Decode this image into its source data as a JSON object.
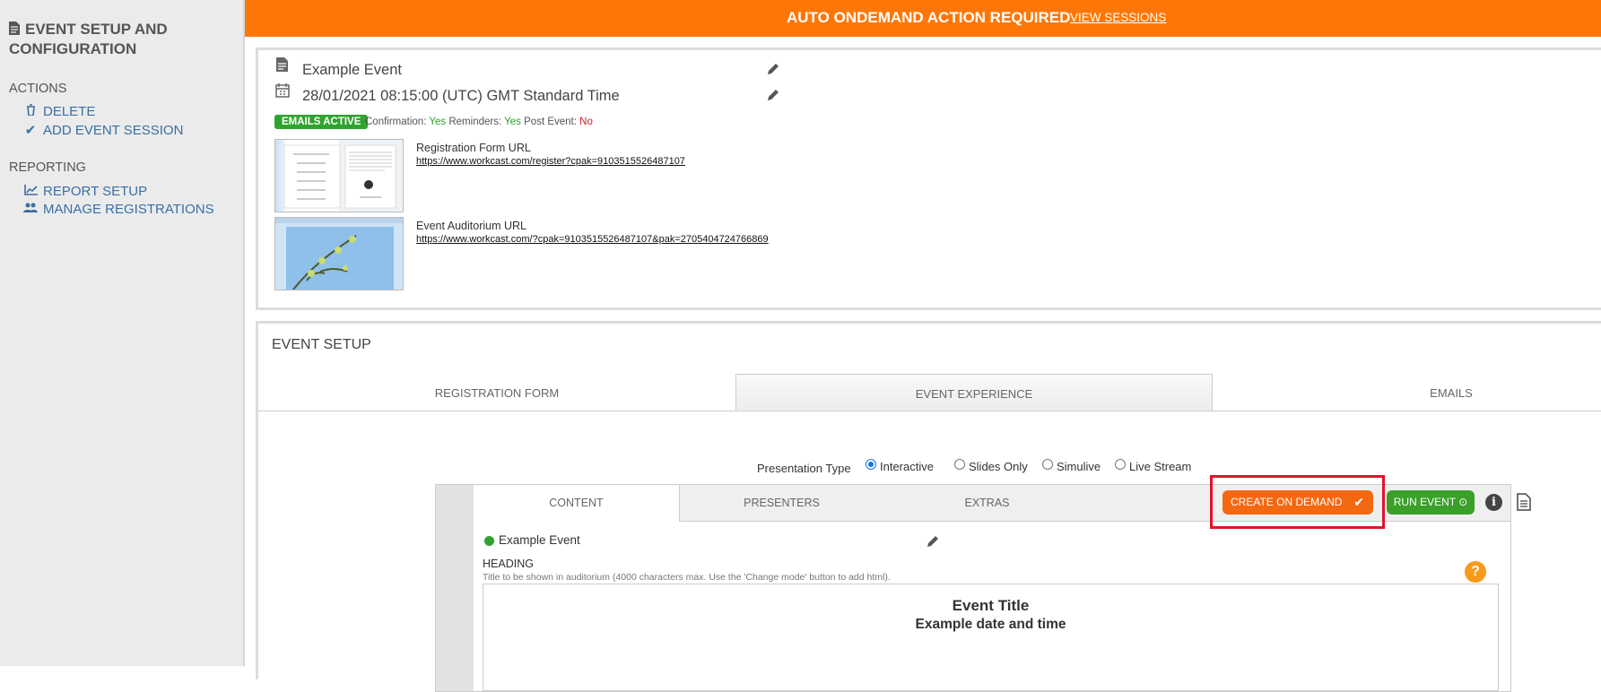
{
  "sidebar": {
    "title": "EVENT SETUP AND CONFIGURATION",
    "actions_heading": "ACTIONS",
    "actions": [
      {
        "label": "DELETE",
        "icon": "trash-icon"
      },
      {
        "label": "ADD EVENT SESSION",
        "icon": "check-icon"
      }
    ],
    "reporting_heading": "REPORTING",
    "reporting": [
      {
        "label": "REPORT SETUP",
        "icon": "line-chart-icon"
      },
      {
        "label": "MANAGE REGISTRATIONS",
        "icon": "users-icon"
      }
    ]
  },
  "banner": {
    "message": "AUTO ONDEMAND ACTION REQUIRED",
    "link": "VIEW SESSIONS",
    "color": "#fe7706"
  },
  "event": {
    "name": "Example Event",
    "datetime": "28/01/2021 08:15:00 (UTC) GMT Standard Time",
    "emails_badge": "EMAILS ACTIVE",
    "confirmation_label": "Confirmation:",
    "confirmation_value": "Yes",
    "reminders_label": "Reminders:",
    "reminders_value": "Yes",
    "post_event_label": "Post Event:",
    "post_event_value": "No",
    "registration_url_label": "Registration Form URL",
    "registration_url": "https://www.workcast.com/register?cpak=9103515526487107",
    "auditorium_url_label": "Event Auditorium URL",
    "auditorium_url": "https://www.workcast.com/?cpak=9103515526487107&pak=2705404724766869"
  },
  "setup": {
    "title": "EVENT SETUP",
    "tabs": [
      "REGISTRATION FORM",
      "EVENT EXPERIENCE",
      "EMAILS"
    ],
    "active_tab": "EVENT EXPERIENCE",
    "presentation_type_label": "Presentation Type",
    "presentation_types": [
      "Interactive",
      "Slides Only",
      "Simulive",
      "Live Stream"
    ],
    "selected_presentation_type": "Interactive"
  },
  "content_panel": {
    "tabs": [
      "CONTENT",
      "PRESENTERS",
      "EXTRAS"
    ],
    "active_tab": "CONTENT",
    "create_on_demand_button": "CREATE ON DEMAND",
    "run_event_button": "RUN EVENT",
    "event_name": "Example Event",
    "heading_label": "HEADING",
    "heading_hint": "Title to be shown in auditorium (4000 characters max. Use the 'Change mode' button to add html).",
    "editor_title": "Event Title",
    "editor_subtitle": "Example date and time"
  }
}
